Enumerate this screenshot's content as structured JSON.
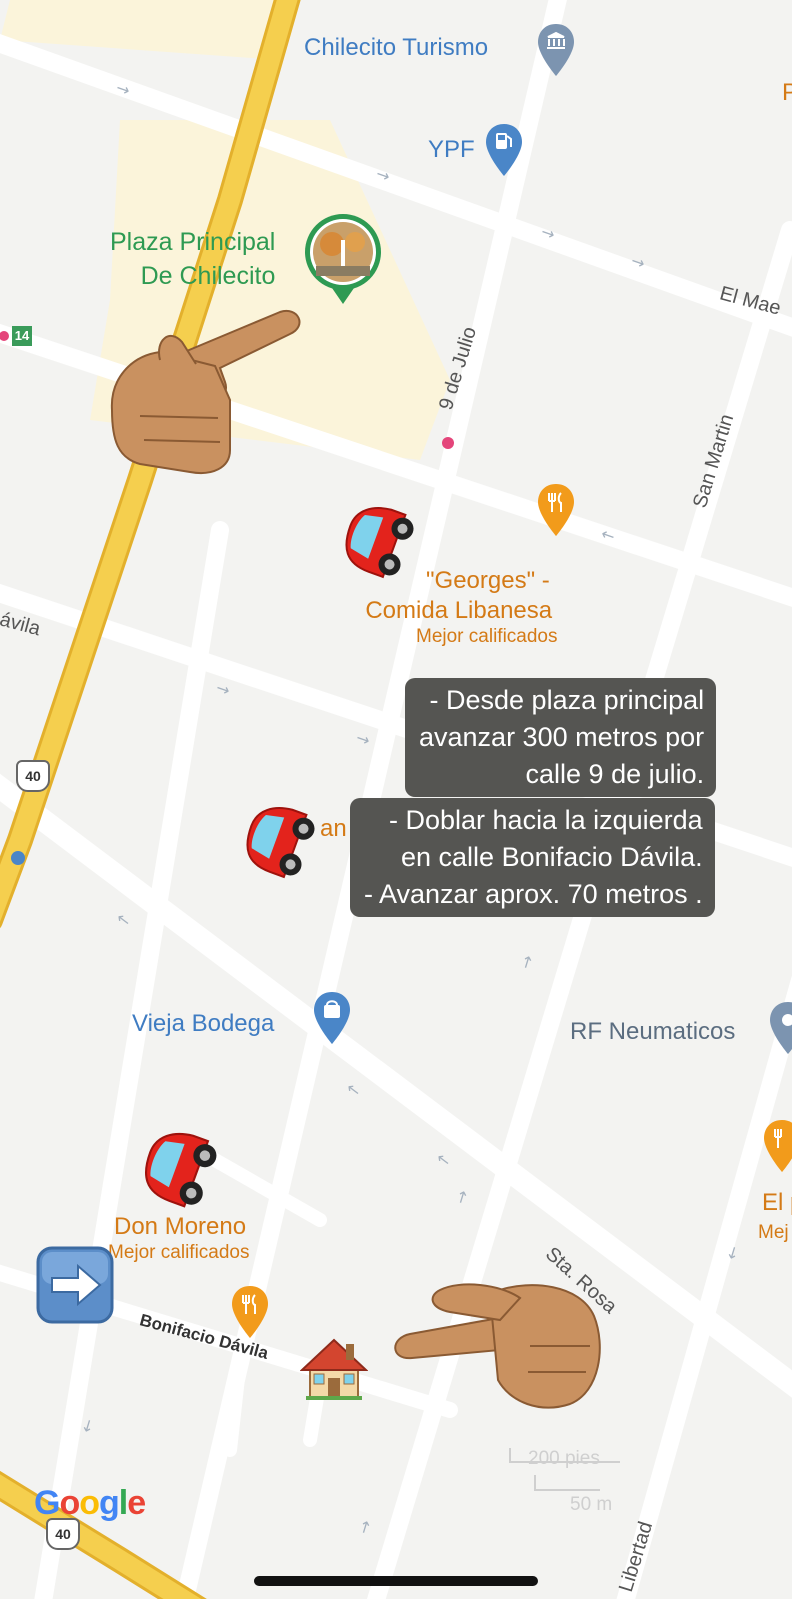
{
  "map": {
    "places": {
      "chilecito_turismo": "Chilecito Turismo",
      "ypf": "YPF",
      "plaza_line1": "Plaza Principal",
      "plaza_line2": "De Chilecito",
      "georges_line1": "\"Georges\" -",
      "georges_line2": "Comida Libanesa",
      "georges_sub": "Mejor calificados",
      "vieja_bodega": "Vieja Bodega",
      "rf_neumaticos": "RF Neumaticos",
      "don_moreno": "Don Moreno",
      "don_moreno_sub": "Mejor calificados",
      "edge_p": "P",
      "edge_el": "El p",
      "edge_mej": "Mej",
      "partial_an": "an"
    },
    "streets": {
      "nueve_de_julio": "9 de Julio",
      "san_martin": "San Martin",
      "el_mae": "El Mae",
      "davila_left": "ávila",
      "sta_rosa": "Sta. Rosa",
      "libertad": "Libertad",
      "bonifacio_davila": "Bonifacio Dávila"
    },
    "routes": {
      "r14": "14",
      "r40_a": "40",
      "r40_b": "40"
    },
    "scale": {
      "feet": "200 pies",
      "meters": "50 m"
    },
    "logo": {
      "letters": [
        "G",
        "o",
        "o",
        "g",
        "l",
        "e"
      ],
      "colors": [
        "#4285F4",
        "#EA4335",
        "#FBBC05",
        "#4285F4",
        "#34A853",
        "#EA4335"
      ]
    },
    "annotation": {
      "box1": [
        "- Desde plaza principal",
        "avanzar 300 metros por",
        "calle 9 de julio."
      ],
      "box2": [
        "- Doblar hacia la izquierda",
        "en calle Bonifacio Dávila.",
        "- Avanzar aprox. 70 metros ."
      ]
    },
    "emoji_icons": [
      "pointing-hand-icon",
      "car-icon",
      "car-icon",
      "car-icon",
      "right-arrow-icon",
      "pointing-hand-icon",
      "house-icon"
    ],
    "colors": {
      "highway": "#f5cf4e",
      "highway_edge": "#e3b02c",
      "street": "#ffffff",
      "background": "#f3f3f1",
      "plaza_area": "#fbf4da",
      "pin_blue": "#4a86c8",
      "pin_orange": "#f29b1b",
      "annotation_bg": "#555552"
    }
  }
}
